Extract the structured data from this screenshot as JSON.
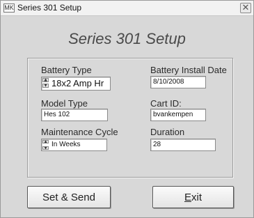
{
  "window": {
    "icon_text": "MK",
    "title": "Series 301 Setup",
    "close_glyph": "✕"
  },
  "heading": "Series 301 Setup",
  "form": {
    "battery_type": {
      "label": "Battery Type",
      "value": "18x2 Amp Hr"
    },
    "battery_install_date": {
      "label": "Battery Install Date",
      "value": "8/10/2008"
    },
    "model_type": {
      "label": "Model Type",
      "value": "Hes 102"
    },
    "cart_id": {
      "label": "Cart ID:",
      "value": "bvankempen"
    },
    "maintenance_cycle": {
      "label": "Maintenance Cycle",
      "value": "In Weeks"
    },
    "duration": {
      "label": "Duration",
      "value": "28"
    }
  },
  "buttons": {
    "set_send": "Set & Send",
    "exit_mnemonic": "E",
    "exit_rest": "xit"
  },
  "icons": [
    "app-icon",
    "close-icon",
    "spinner-up-icon",
    "spinner-down-icon"
  ]
}
